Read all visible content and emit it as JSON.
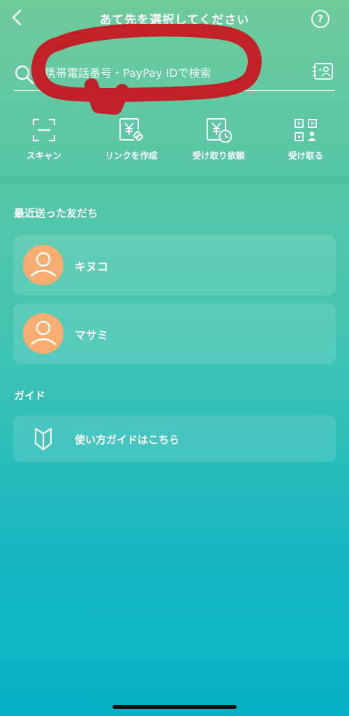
{
  "header": {
    "title": "あて先を選択してください",
    "help_label": "?"
  },
  "search": {
    "placeholder": "携帯電話番号・PayPay IDで検索",
    "value": ""
  },
  "actions": [
    {
      "label": "スキャン",
      "icon": "scan-icon"
    },
    {
      "label": "リンクを作成",
      "icon": "yen-link-icon"
    },
    {
      "label": "受け取り依頼",
      "icon": "yen-clock-icon"
    },
    {
      "label": "受け取る",
      "icon": "qr-user-icon"
    }
  ],
  "recent": {
    "title": "最近送った友だち",
    "friends": [
      {
        "name": "キヌコ",
        "avatar": "person-icon"
      },
      {
        "name": "マサミ",
        "avatar": "person-icon"
      }
    ]
  },
  "guide": {
    "title": "ガイド",
    "item_label": "使い方ガイドはこちら",
    "icon": "beginner-mark-icon"
  },
  "colors": {
    "gradient_top": "#6ecb9a",
    "gradient_bottom": "#07b2c6",
    "avatar": "#f9ad70",
    "scribble": "#c8141e"
  }
}
